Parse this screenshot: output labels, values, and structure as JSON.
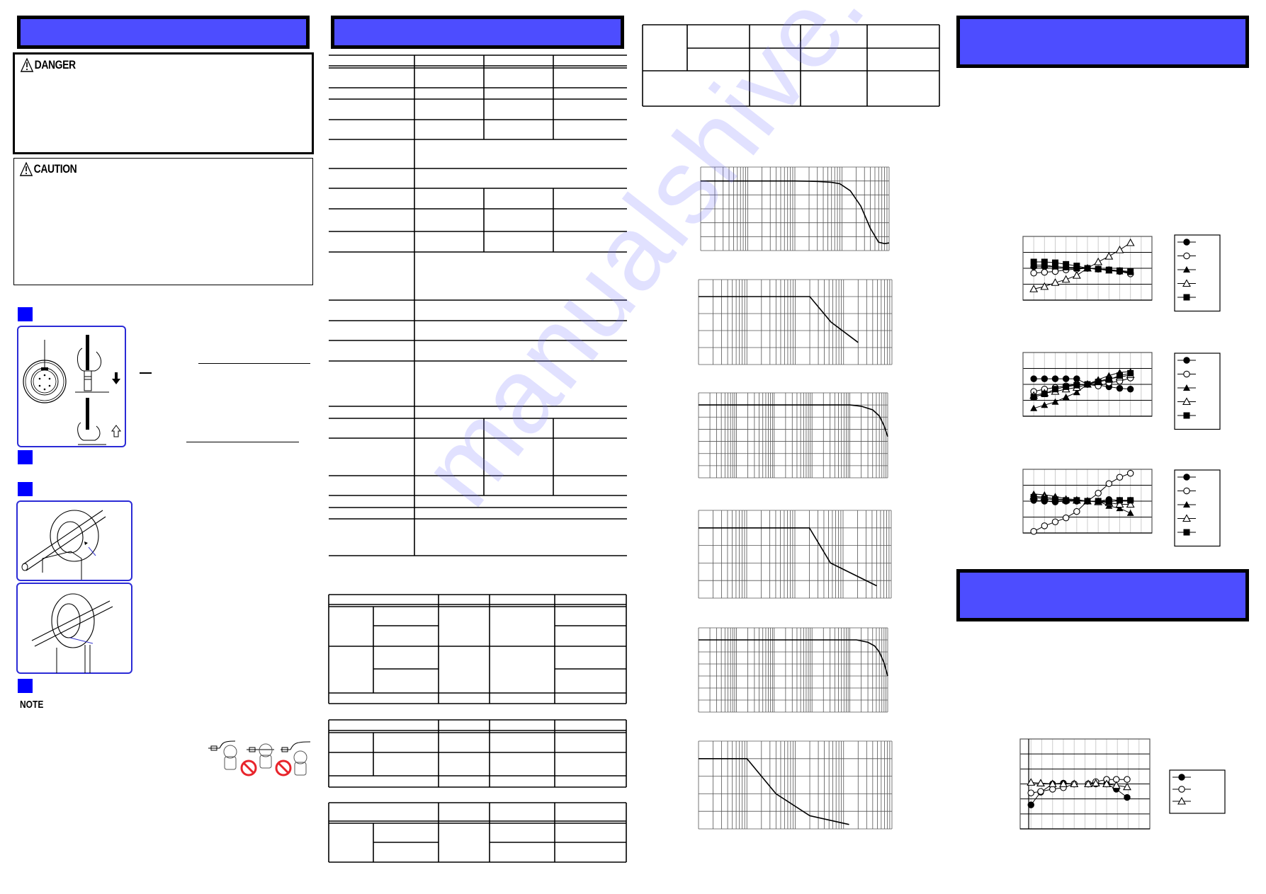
{
  "page": {
    "header_color": "#4d4dff",
    "step_marker_color": "#0000ff",
    "figure_border_color": "#2b2bd6",
    "watermark_text": "manualshive.com"
  },
  "column1": {
    "danger": {
      "title": "DANGER",
      "icon": "warning-triangle-icon"
    },
    "caution": {
      "title": "CAUTION",
      "icon": "warning-triangle-icon"
    },
    "note_label": "NOTE",
    "figures": [
      {
        "name": "connector-figure",
        "icons": [
          "connector-face-icon",
          "arrow-down-icon",
          "arrow-up-outline-icon"
        ]
      },
      {
        "name": "clamp-figure-1"
      },
      {
        "name": "clamp-figure-2"
      }
    ],
    "prohibition_icons": [
      "correct-clamp-icon",
      "prohibited-icon",
      "prohibited-icon"
    ]
  },
  "chart_data": [
    {
      "id": "freq-response-1",
      "type": "line",
      "title": "",
      "xlabel": "",
      "ylabel": "",
      "xscale": "log",
      "grid": true,
      "xlim": [
        1,
        10000
      ],
      "ylim": [
        0,
        6
      ],
      "series": [
        {
          "name": "",
          "x": [
            1,
            100,
            300,
            600,
            900,
            1500,
            2500,
            4000,
            6000,
            8000,
            10000
          ],
          "y": [
            5,
            5,
            4.97,
            4.9,
            4.8,
            4.3,
            3.2,
            1.6,
            0.6,
            0.5,
            0.55
          ]
        }
      ]
    },
    {
      "id": "derating-1",
      "type": "line",
      "title": "",
      "xlabel": "",
      "ylabel": "",
      "xscale": "log",
      "grid": true,
      "xlim": [
        1,
        10000
      ],
      "ylim": [
        0,
        5
      ],
      "series": [
        {
          "name": "",
          "x": [
            1,
            200,
            550,
            2000
          ],
          "y": [
            4,
            4,
            2.5,
            1.3
          ]
        }
      ]
    },
    {
      "id": "freq-response-2",
      "type": "line",
      "title": "",
      "xlabel": "",
      "ylabel": "",
      "xscale": "log",
      "grid": true,
      "xlim": [
        1,
        100000
      ],
      "ylim": [
        0,
        7
      ],
      "series": [
        {
          "name": "",
          "x": [
            1,
            10000,
            20000,
            40000,
            60000,
            80000,
            100000
          ],
          "y": [
            6,
            6,
            5.9,
            5.6,
            5.1,
            4.3,
            3.4
          ]
        }
      ]
    },
    {
      "id": "derating-2",
      "type": "line",
      "title": "",
      "xlabel": "",
      "ylabel": "",
      "xscale": "log",
      "grid": true,
      "xlim": [
        1,
        10000
      ],
      "ylim": [
        0,
        5
      ],
      "series": [
        {
          "name": "",
          "x": [
            1,
            200,
            550,
            5000
          ],
          "y": [
            4,
            4,
            2,
            0.7
          ]
        }
      ]
    },
    {
      "id": "freq-response-3",
      "type": "line",
      "title": "",
      "xlabel": "",
      "ylabel": "",
      "xscale": "log",
      "grid": true,
      "xlim": [
        1,
        100000
      ],
      "ylim": [
        0,
        7
      ],
      "series": [
        {
          "name": "",
          "x": [
            1,
            15000,
            30000,
            45000,
            60000,
            80000,
            100000
          ],
          "y": [
            6,
            6,
            5.8,
            5.5,
            5.0,
            4.1,
            3.0
          ]
        }
      ]
    },
    {
      "id": "derating-3",
      "type": "line",
      "title": "",
      "xlabel": "",
      "ylabel": "",
      "xscale": "log",
      "grid": true,
      "xlim": [
        1,
        10000
      ],
      "ylim": [
        0,
        5
      ],
      "series": [
        {
          "name": "",
          "x": [
            1,
            10,
            40,
            200,
            1300
          ],
          "y": [
            4,
            4,
            2,
            0.75,
            0.25
          ]
        }
      ]
    },
    {
      "id": "characteristics-a",
      "type": "line",
      "title": "",
      "xlabel": "",
      "ylabel": "",
      "categories": [
        1,
        2,
        3,
        4,
        5,
        6,
        7,
        8,
        9,
        10
      ],
      "ylim": [
        -2,
        2
      ],
      "grid": true,
      "legend": "right",
      "series": [
        {
          "name": "",
          "marker": "filled-circle",
          "values": [
            0.1,
            0.1,
            0.1,
            0.05,
            0.05,
            0,
            -0.05,
            -0.1,
            -0.15,
            -0.3
          ]
        },
        {
          "name": "",
          "marker": "open-circle",
          "values": [
            -0.3,
            -0.25,
            -0.2,
            -0.1,
            -0.05,
            0,
            -0.05,
            -0.1,
            -0.2,
            -0.35
          ]
        },
        {
          "name": "",
          "marker": "filled-triangle",
          "values": [
            0.2,
            0.2,
            0.1,
            0.05,
            0,
            0,
            -0.05,
            -0.15,
            -0.2,
            -0.25
          ]
        },
        {
          "name": "",
          "marker": "open-triangle",
          "values": [
            -1.3,
            -1.15,
            -0.9,
            -0.7,
            -0.45,
            0,
            0.4,
            0.75,
            1.15,
            1.6
          ]
        },
        {
          "name": "",
          "marker": "filled-square",
          "values": [
            0.4,
            0.4,
            0.35,
            0.25,
            0.15,
            0,
            -0.05,
            -0.1,
            -0.15,
            -0.2
          ]
        }
      ]
    },
    {
      "id": "characteristics-b",
      "type": "line",
      "title": "",
      "xlabel": "",
      "ylabel": "",
      "categories": [
        1,
        2,
        3,
        4,
        5,
        6,
        7,
        8,
        9,
        10
      ],
      "ylim": [
        -2,
        2
      ],
      "grid": true,
      "legend": "right",
      "series": [
        {
          "name": "",
          "marker": "filled-circle",
          "values": [
            0.35,
            0.35,
            0.35,
            0.35,
            0.35,
            0,
            -0.05,
            -0.15,
            -0.25,
            -0.3
          ]
        },
        {
          "name": "",
          "marker": "open-circle",
          "values": [
            -0.45,
            -0.3,
            -0.2,
            -0.1,
            0,
            0,
            -0.1,
            0.1,
            0.2,
            0.4
          ]
        },
        {
          "name": "",
          "marker": "filled-triangle",
          "values": [
            -1.5,
            -1.3,
            -1.1,
            -0.8,
            -0.5,
            0,
            0.3,
            0.55,
            0.75,
            0.8
          ]
        },
        {
          "name": "",
          "marker": "open-triangle",
          "values": [
            -0.7,
            -0.55,
            -0.45,
            -0.3,
            -0.2,
            0,
            0.2,
            0.35,
            0.45,
            0.6
          ]
        },
        {
          "name": "",
          "marker": "filled-square",
          "values": [
            -0.8,
            -0.6,
            -0.3,
            -0.15,
            -0.05,
            0,
            0.15,
            0.3,
            0.55,
            0.7
          ]
        }
      ]
    },
    {
      "id": "characteristics-c",
      "type": "line",
      "title": "",
      "xlabel": "",
      "ylabel": "",
      "categories": [
        1,
        2,
        3,
        4,
        5,
        6,
        7,
        8,
        9,
        10
      ],
      "ylim": [
        -2,
        2
      ],
      "grid": true,
      "legend": "right",
      "series": [
        {
          "name": "",
          "marker": "filled-circle",
          "values": [
            0.05,
            0,
            -0.05,
            0,
            0,
            0,
            0,
            0.1,
            0.05,
            0.05
          ]
        },
        {
          "name": "",
          "marker": "open-circle",
          "values": [
            -1.9,
            -1.55,
            -1.3,
            -1.05,
            -0.65,
            0,
            0.5,
            1.1,
            1.5,
            1.75
          ]
        },
        {
          "name": "",
          "marker": "filled-triangle",
          "values": [
            0.45,
            0.4,
            0.3,
            0.15,
            0.1,
            0,
            0,
            -0.3,
            -0.45,
            -0.75
          ]
        },
        {
          "name": "",
          "marker": "open-triangle",
          "values": [
            0.3,
            0.25,
            0.15,
            0.1,
            0.05,
            0,
            -0.05,
            -0.1,
            -0.2,
            -0.2
          ]
        },
        {
          "name": "",
          "marker": "filled-square",
          "values": [
            0.25,
            0.15,
            0.1,
            0.05,
            0.05,
            0,
            0,
            -0.05,
            0.05,
            0.05
          ]
        }
      ]
    },
    {
      "id": "characteristics-d",
      "type": "line",
      "title": "",
      "xlabel": "",
      "ylabel": "",
      "x": [
        1,
        2,
        3,
        4,
        5,
        6,
        7,
        8,
        9,
        10
      ],
      "ylim": [
        -3,
        3
      ],
      "grid": true,
      "legend": "right",
      "series": [
        {
          "name": "",
          "marker": "filled-circle",
          "x": [
            1.0,
            1.9,
            3.0,
            4.0,
            5.0,
            6.3,
            7.0,
            8.0,
            8.9,
            9.9
          ],
          "values": [
            -1.4,
            -0.55,
            0,
            0.05,
            0,
            0,
            0,
            0,
            -0.35,
            -0.9
          ]
        },
        {
          "name": "",
          "marker": "open-circle",
          "x": [
            1.0,
            1.9,
            3.0,
            4.0,
            5.0,
            6.3,
            7.0,
            8.0,
            8.9,
            9.9
          ],
          "values": [
            -0.6,
            -0.5,
            -0.35,
            -0.25,
            0,
            0,
            0.15,
            0.3,
            0.3,
            0.3
          ]
        },
        {
          "name": "",
          "marker": "open-triangle",
          "x": [
            1.0,
            1.9,
            3.0,
            4.0,
            5.0,
            6.3,
            7.0,
            8.0,
            8.9,
            9.9
          ],
          "values": [
            0.1,
            0.05,
            0,
            0,
            0,
            0,
            0.05,
            0,
            -0.1,
            -0.2
          ]
        }
      ]
    }
  ]
}
